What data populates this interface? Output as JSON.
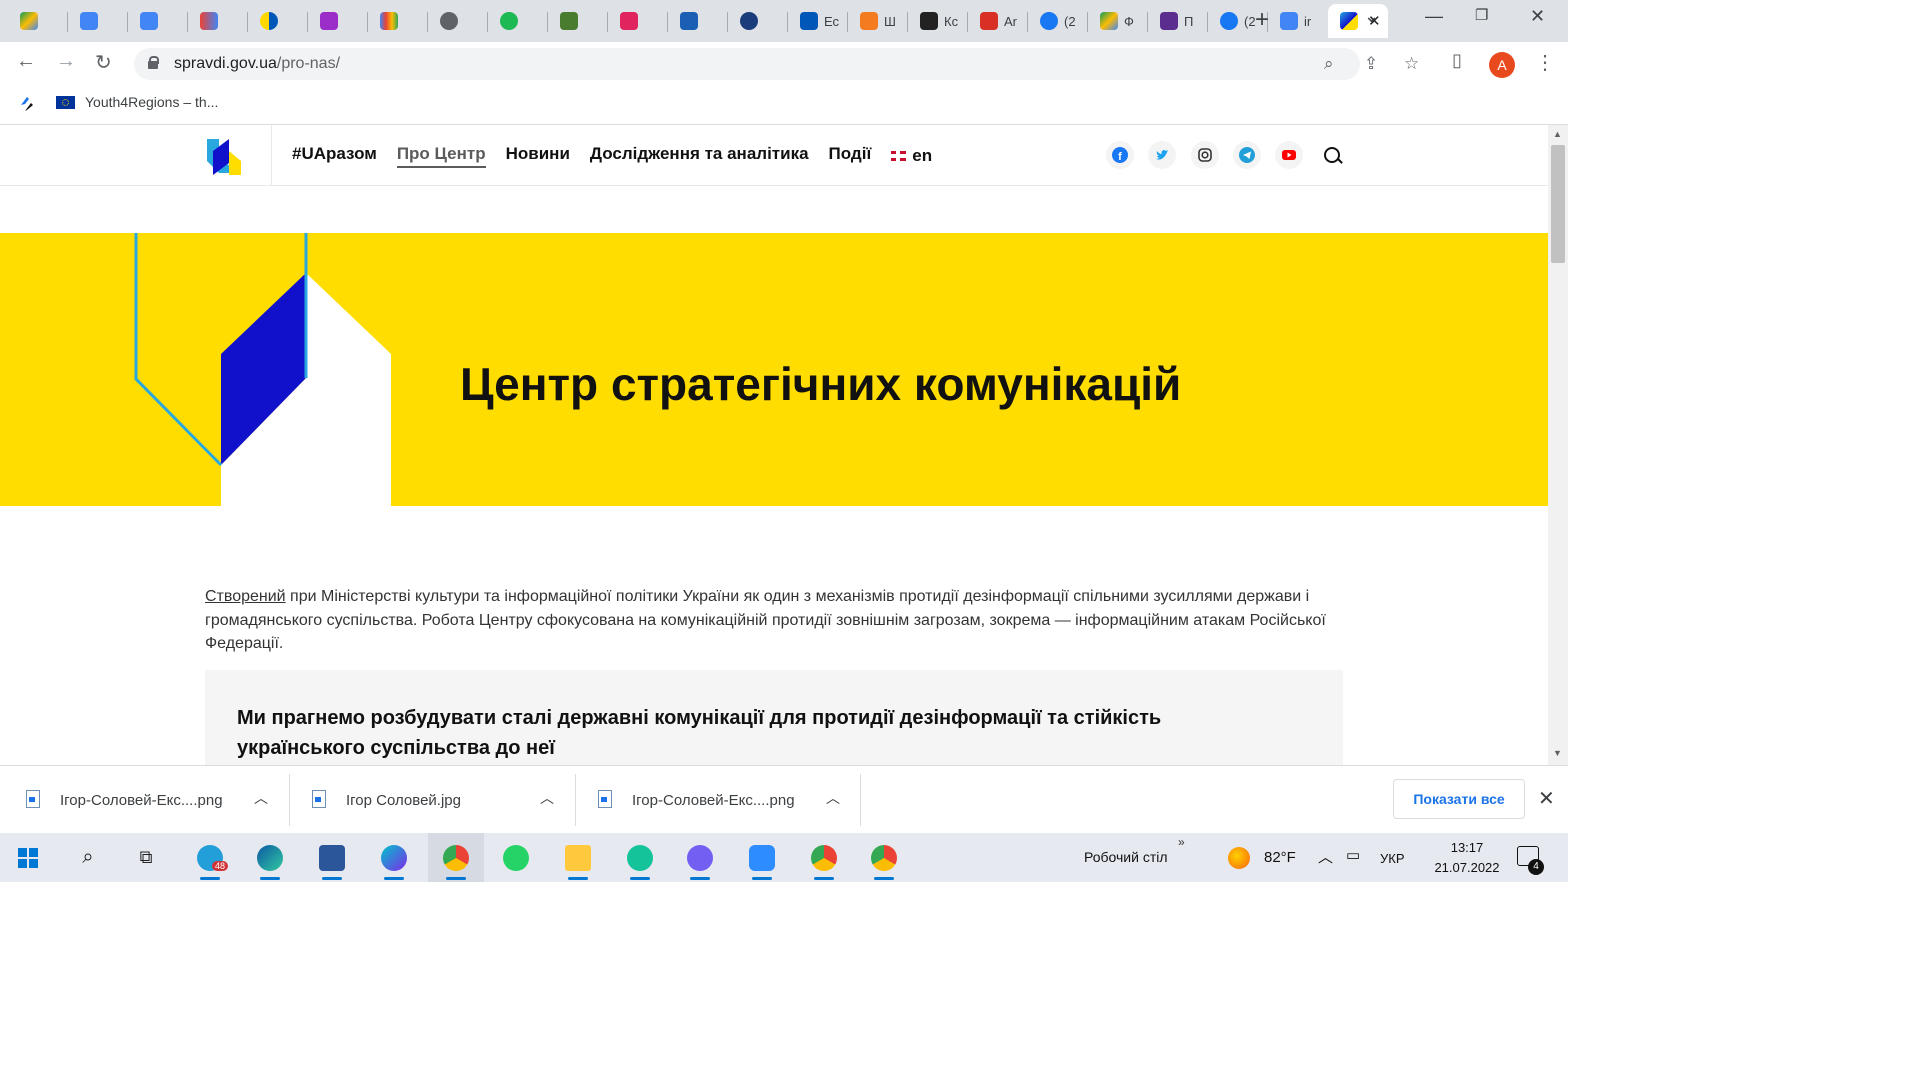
{
  "browser": {
    "tabs": [
      {
        "icon": "google-drive-icon",
        "label": ""
      },
      {
        "icon": "google-docs-icon",
        "label": ""
      },
      {
        "icon": "google-translate-icon",
        "label": ""
      },
      {
        "icon": "gmail-icon",
        "label": ""
      },
      {
        "icon": "ua-ring-icon",
        "label": ""
      },
      {
        "icon": "podcasts-icon",
        "label": ""
      },
      {
        "icon": "google-podcasts-icon",
        "label": ""
      },
      {
        "icon": "globe-icon",
        "label": ""
      },
      {
        "icon": "spotify-icon",
        "label": ""
      },
      {
        "icon": "coat-of-arms-icon",
        "label": ""
      },
      {
        "icon": "infinity-icon",
        "label": ""
      },
      {
        "icon": "flag-app-icon",
        "label": ""
      },
      {
        "icon": "circle-arrow-icon",
        "label": ""
      },
      {
        "icon": "u-logo-icon",
        "label": "Ес"
      },
      {
        "icon": "pen-icon",
        "label": "Ш"
      },
      {
        "icon": "horse-icon",
        "label": "Кс"
      },
      {
        "icon": "b-logo-icon",
        "label": "Ar"
      },
      {
        "icon": "facebook-icon",
        "label": "(2"
      },
      {
        "icon": "google-drive-icon",
        "label": "Ф"
      },
      {
        "icon": "list-app-icon",
        "label": "П"
      },
      {
        "icon": "facebook-icon",
        "label": "(2"
      },
      {
        "icon": "google-icon",
        "label": "ir"
      },
      {
        "icon": "spravdi-logo-icon",
        "label": "",
        "active": true
      }
    ],
    "url_domain": "spravdi.gov.ua",
    "url_path": "/pro-nas/",
    "profile_initial": "A",
    "bookmark_label": "Youth4Regions – th..."
  },
  "site": {
    "nav": [
      {
        "label": "#UAразом"
      },
      {
        "label": "Про Центр",
        "active": true
      },
      {
        "label": "Новини"
      },
      {
        "label": "Дослідження та аналітика"
      },
      {
        "label": "Події"
      }
    ],
    "lang_label": "en",
    "social_icons": [
      "facebook-icon",
      "twitter-icon",
      "instagram-icon",
      "telegram-icon",
      "youtube-icon"
    ],
    "hero_title": "Центр стратегічних комунікацій",
    "intro_link": "Створений",
    "intro_rest": " при Міністерстві культури та інформаційної політики України як один з механізмів протидії дезінформації спільними зусиллями держави і громадянського суспільства. Робота Центру сфокусована на комунікаційній протидії зовнішнім загрозам, зокрема — інформаційним атакам Російської Федерації.",
    "mission_text": "Ми прагнемо розбудувати сталі державні комунікації для протидії дезінформації та стійкість українського суспільства до неї"
  },
  "downloads": {
    "files": [
      "Ігор-Соловей-Екс....png",
      "Ігор Соловей.jpg",
      "Ігор-Соловей-Екс....png"
    ],
    "show_all": "Показати все"
  },
  "taskbar": {
    "telegram_badge": "48",
    "desktop_label": "Робочий стіл",
    "temperature": "82°F",
    "input_lang": "УКР",
    "time": "13:17",
    "date": "21.07.2022",
    "notification_count": "4"
  },
  "colors": {
    "brand_yellow": "#ffdd00",
    "brand_blue": "#1111cc",
    "accent_cyan": "#29a8e0",
    "link_blue": "#1a73e8"
  }
}
